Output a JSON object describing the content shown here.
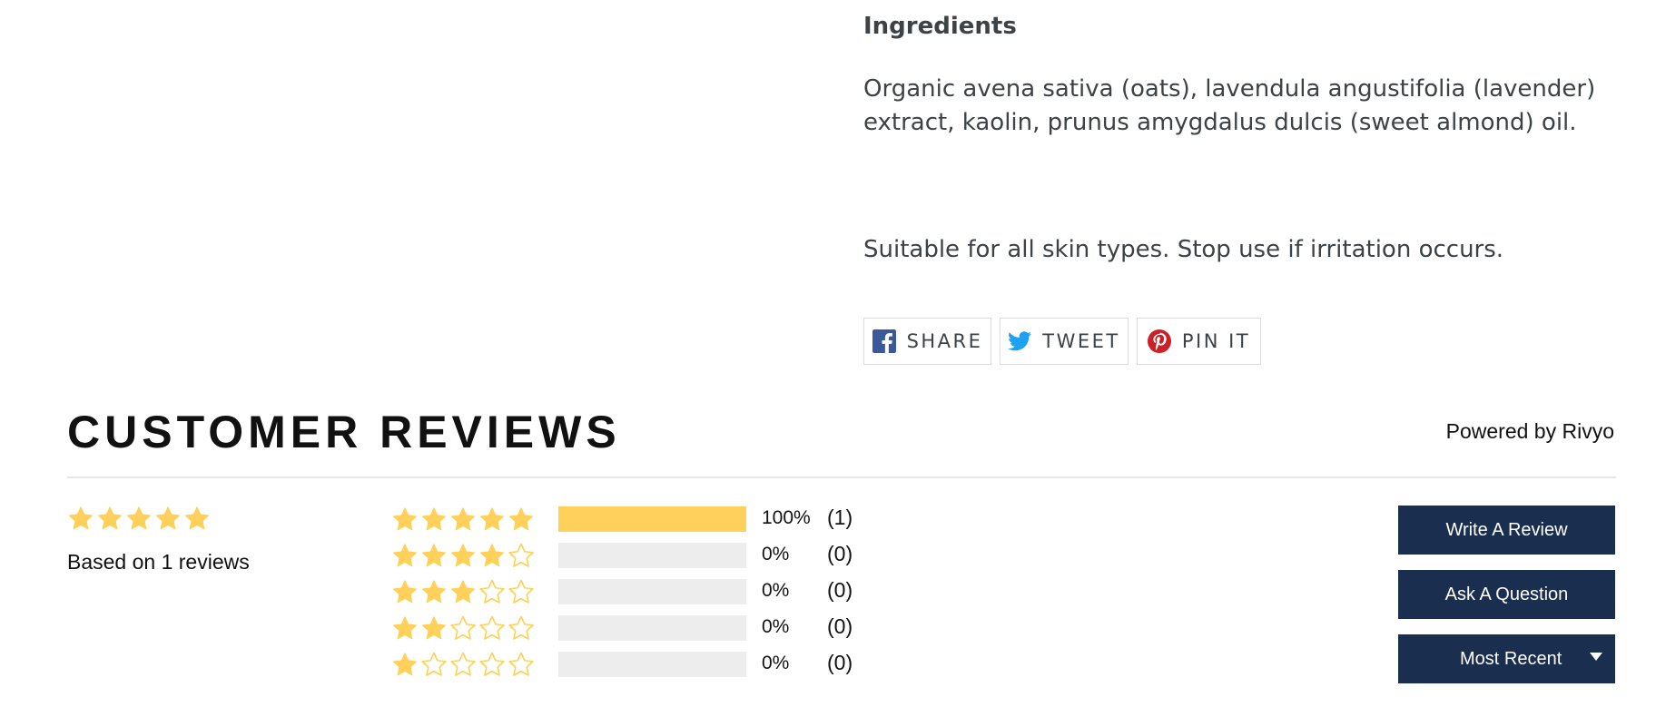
{
  "product": {
    "ingredients_heading": "Ingredients",
    "ingredients_text": "Organic avena sativa (oats), lavendula angustifolia (lavender) extract, kaolin, prunus amygdalus dulcis (sweet almond) oil.",
    "suitability_note": "Suitable for all skin types. Stop use if irritation occurs."
  },
  "share": {
    "facebook_label": "SHARE",
    "twitter_label": "TWEET",
    "pinterest_label": "PIN IT",
    "facebook_color": "#3b5998",
    "twitter_color": "#1da1f2",
    "pinterest_color": "#cb2027"
  },
  "reviews": {
    "title": "CUSTOMER REVIEWS",
    "powered_by": "Powered by Rivyo",
    "average_rating": 5,
    "based_on": "Based on 1 reviews",
    "distribution": [
      {
        "stars": 5,
        "fraction": 1.0,
        "percent_label": "100%",
        "count_label": "(1)"
      },
      {
        "stars": 4,
        "fraction": 0.0,
        "percent_label": "0%",
        "count_label": "(0)"
      },
      {
        "stars": 3,
        "fraction": 0.0,
        "percent_label": "0%",
        "count_label": "(0)"
      },
      {
        "stars": 2,
        "fraction": 0.0,
        "percent_label": "0%",
        "count_label": "(0)"
      },
      {
        "stars": 1,
        "fraction": 0.0,
        "percent_label": "0%",
        "count_label": "(0)"
      }
    ],
    "write_review_label": "Write A Review",
    "ask_question_label": "Ask A Question",
    "sort_selected": "Most Recent"
  },
  "colors": {
    "star": "#ffd15a",
    "bar_fill": "#ffd15a",
    "bar_track": "#ededed",
    "button_bg": "#1a2e4f"
  }
}
